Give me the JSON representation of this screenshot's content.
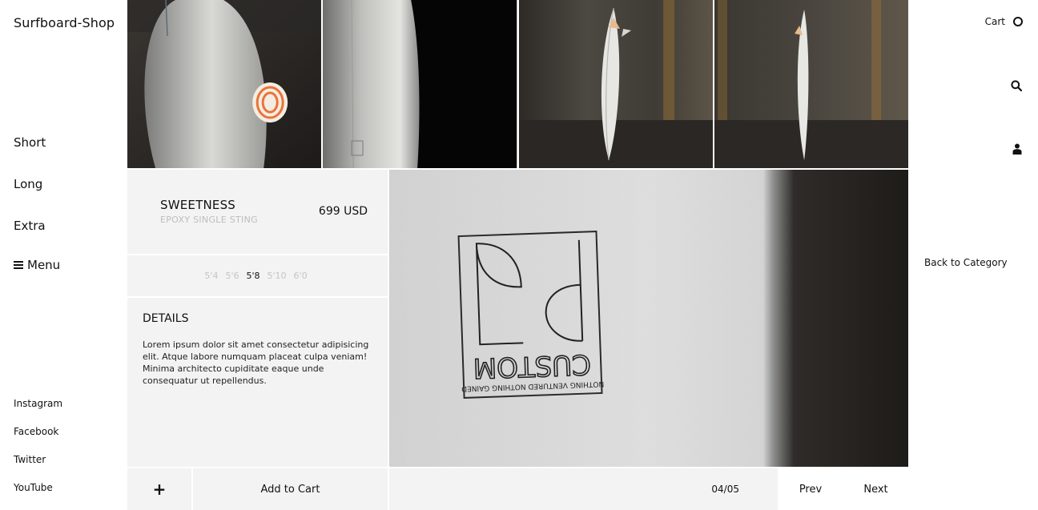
{
  "brand": "Surfboard-Shop",
  "nav": {
    "items": [
      {
        "label": "Short"
      },
      {
        "label": "Long"
      },
      {
        "label": "Extra"
      }
    ],
    "menu_label": "Menu"
  },
  "social": [
    {
      "label": "Instagram"
    },
    {
      "label": "Facebook"
    },
    {
      "label": "Twitter"
    },
    {
      "label": "YouTube"
    }
  ],
  "header": {
    "cart_label": "Cart",
    "icons": [
      "circle-icon",
      "search-icon",
      "user-icon"
    ]
  },
  "product": {
    "name": "SWEETNESS",
    "subtitle": "EPOXY SINGLE STING",
    "price": "699 USD",
    "sizes": [
      {
        "label": "5'4",
        "active": false
      },
      {
        "label": "5'6",
        "active": false
      },
      {
        "label": "5'8",
        "active": true
      },
      {
        "label": "5'10",
        "active": false
      },
      {
        "label": "6'0",
        "active": false
      }
    ],
    "details_title": "DETAILS",
    "details_text": "Lorem ipsum dolor sit amet consectetur adipisicing elit. Atque labore numquam placeat culpa veniam! Minima architecto cupiditate eaque unde consequatur ut repellendus."
  },
  "actions": {
    "plus": "+",
    "add_to_cart": "Add to Cart",
    "counter": "04/05",
    "prev": "Prev",
    "next": "Next"
  },
  "back_to_category": "Back to Category",
  "logo_mark": {
    "text_top": "NOTHING VENTURED NOTHING GAINED",
    "text_brand": "CUSTOM"
  },
  "colors": {
    "panel_bg": "#f3f3f3",
    "muted_text": "#c4c4c4",
    "accent_fin": "#e8743b"
  }
}
